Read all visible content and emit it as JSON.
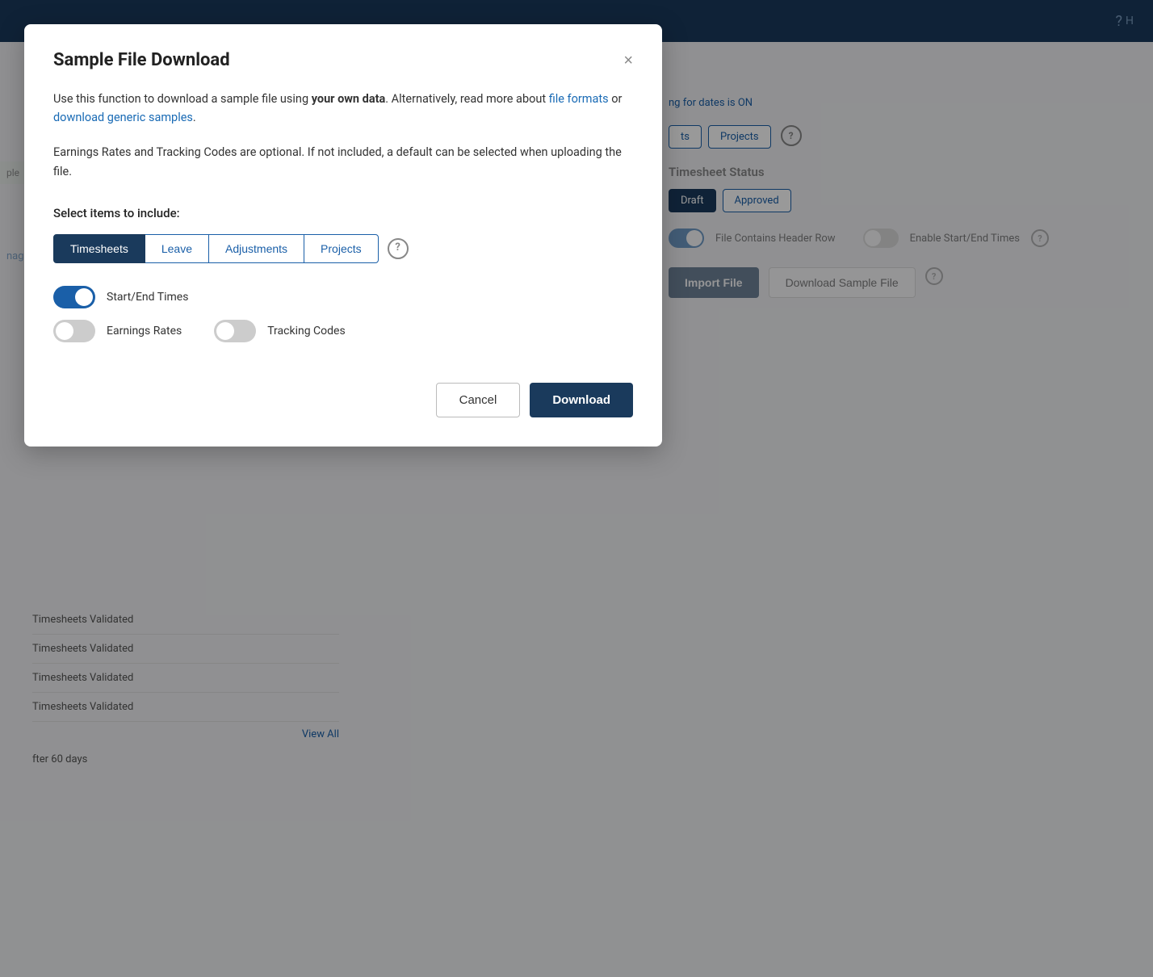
{
  "header": {
    "help_icon": "?"
  },
  "background": {
    "right_panel": {
      "info_text": "ng for dates is ON",
      "tabs": [
        "ts",
        "Projects"
      ],
      "timesheet_status_label": "Timesheet Status",
      "status_tabs": [
        "Draft",
        "Approved"
      ],
      "file_header_toggle_label": "File Contains Header Row",
      "start_end_toggle_label": "Enable Start/End Times",
      "import_button": "Import File",
      "download_sample_button": "Download Sample File"
    },
    "left_panel": {
      "items": [
        "Timesheets Validated",
        "Timesheets Validated",
        "Timesheets Validated",
        "Timesheets Validated"
      ],
      "view_all": "View All",
      "footer_text": "fter 60 days"
    }
  },
  "modal": {
    "title": "Sample File Download",
    "close_label": "×",
    "description_part1": "Use this function to download a sample file using ",
    "description_bold": "your own data",
    "description_part2": ". Alternatively, read more about ",
    "link1": "file formats",
    "description_part3": " or ",
    "link2": "download generic samples",
    "description_part4": ".",
    "info_text": "Earnings Rates and Tracking Codes are optional. If not included, a default can be selected when uploading the file.",
    "select_label": "Select items to include:",
    "tabs": [
      {
        "label": "Timesheets",
        "active": true
      },
      {
        "label": "Leave",
        "active": false
      },
      {
        "label": "Adjustments",
        "active": false
      },
      {
        "label": "Projects",
        "active": false
      }
    ],
    "toggles": [
      {
        "label": "Start/End Times",
        "on": true
      },
      {
        "label": "Earnings Rates",
        "on": false
      },
      {
        "label": "Tracking Codes",
        "on": false
      }
    ],
    "cancel_label": "Cancel",
    "download_label": "Download"
  }
}
